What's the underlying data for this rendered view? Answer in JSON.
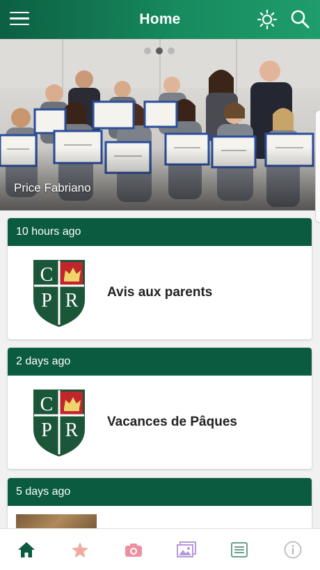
{
  "header": {
    "title": "Home",
    "menu_icon": "hamburger-icon",
    "theme_icon": "sun-icon",
    "search_icon": "search-icon"
  },
  "hero": {
    "caption": "Price Fabriano",
    "slide_count": 3,
    "active_slide": 1
  },
  "cards": [
    {
      "time": "10 hours ago",
      "title": "Avis aux parents"
    },
    {
      "time": "2 days ago",
      "title": "Vacances de Pâques"
    },
    {
      "time": "5 days ago",
      "title": ""
    }
  ],
  "crest": {
    "letters": [
      "C",
      "P",
      "R"
    ]
  },
  "bottom_nav": [
    {
      "name": "home",
      "icon": "home-icon",
      "color": "#0b5b40",
      "active": true
    },
    {
      "name": "favorites",
      "icon": "star-icon",
      "color": "#f2a9a0"
    },
    {
      "name": "camera",
      "icon": "camera-icon",
      "color": "#ec8fa0"
    },
    {
      "name": "gallery",
      "icon": "images-icon",
      "color": "#b59ad8"
    },
    {
      "name": "list",
      "icon": "list-icon",
      "color": "#6aa08a"
    },
    {
      "name": "info",
      "icon": "info-icon",
      "color": "#bbbbbb"
    }
  ],
  "colors": {
    "primary": "#0b5b40",
    "crest_red": "#c0262b",
    "crest_green": "#1a5637"
  }
}
